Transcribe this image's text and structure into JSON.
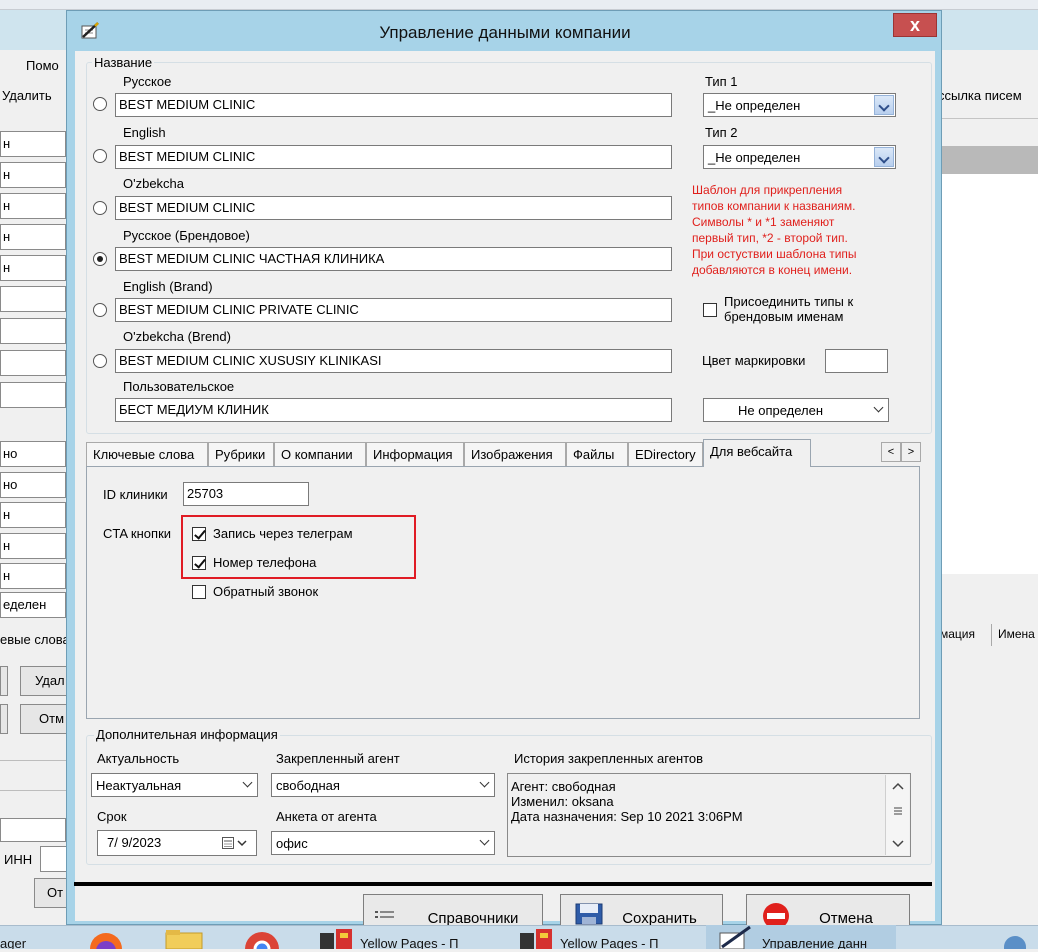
{
  "background_app": {
    "menu_item": "Помо",
    "delete_label": "Удалить",
    "mailing_label": "ссылка писем",
    "left_fields": [
      "н",
      "н",
      "н",
      "н",
      "н",
      "",
      "",
      "",
      "",
      "но",
      "но",
      "н",
      "н",
      "н",
      "еделен"
    ],
    "keywords_tab": "евые слова",
    "delete_button": "Удал",
    "cancel_button": "Отм",
    "inn_label": "ИНН",
    "bottom_button": "От",
    "right_tabs": [
      "мация",
      "Имена"
    ]
  },
  "dialog": {
    "title": "Управление данными компании",
    "close_symbol": "x",
    "name_group": {
      "legend": "Название",
      "fields": [
        {
          "label": "Русское",
          "value": "BEST MEDIUM CLINIC",
          "selected": false
        },
        {
          "label": "English",
          "value": "BEST MEDIUM CLINIC",
          "selected": false
        },
        {
          "label": "O'zbekcha",
          "value": "BEST MEDIUM CLINIC",
          "selected": false
        },
        {
          "label": "Русское (Брендовое)",
          "value": "BEST MEDIUM CLINIC ЧАСТНАЯ КЛИНИКА",
          "selected": true
        },
        {
          "label": "English (Brand)",
          "value": "BEST MEDIUM CLINIC PRIVATE CLINIC",
          "selected": false
        },
        {
          "label": "O'zbekcha (Brend)",
          "value": "BEST MEDIUM CLINIC XUSUSIY KLINIKASI",
          "selected": false
        },
        {
          "label": "Пользовательское",
          "value": "БЕСТ МЕДИУМ КЛИНИК"
        }
      ],
      "type1_label": "Тип 1",
      "type1_value": "_Не определен",
      "type2_label": "Тип 2",
      "type2_value": "_Не определен",
      "template_note": [
        "Шаблон для прикрепления",
        "типов компании к названиям.",
        "Символы * и *1 заменяют",
        "первый тип, *2 - второй тип.",
        "При остуствии шаблона типы",
        "добавляются в конец имени."
      ],
      "attach_types_label_line1": "Присоединить типы к",
      "attach_types_label_line2": "брендовым именам",
      "attach_types_checked": false,
      "color_label": "Цвет маркировки",
      "color_value": "",
      "custom_type_value": "Не определен"
    },
    "tabs": [
      "Ключевые слова",
      "Рубрики",
      "О компании",
      "Информация",
      "Изображения",
      "Файлы",
      "EDirectory",
      "Для вебсайта"
    ],
    "active_tab": "Для вебсайта",
    "tab_scroll_left": "<",
    "tab_scroll_right": ">",
    "website": {
      "clinic_id_label": "ID клиники",
      "clinic_id_value": "25703",
      "cta_label": "CTA кнопки",
      "cta": [
        {
          "label": "Запись через телеграм",
          "checked": true
        },
        {
          "label": "Номер телефона",
          "checked": true
        },
        {
          "label": "Обратный звонок",
          "checked": false
        }
      ]
    },
    "additional": {
      "legend": "Дополнительная информация",
      "relevance_label": "Актуальность",
      "relevance_value": "Неактуальная",
      "agent_label": "Закрепленный агент",
      "agent_value": "свободная",
      "history_label": "История закрепленных агентов",
      "history_lines": [
        "Агент: свободная",
        "Изменил: oksana",
        "Дата назначения: Sep 10 2021  3:06PM"
      ],
      "term_label": "Срок",
      "term_value": "7/  9/2023",
      "form_label": "Анкета от агента",
      "form_value": "офис"
    },
    "buttons": {
      "references": "Справочники",
      "save": "Сохранить",
      "cancel": "Отмена"
    }
  },
  "taskbar": {
    "items": [
      "ager",
      "Yellow Pages - П",
      "Yellow Pages - П",
      "Управление данн"
    ]
  },
  "colors": {
    "dialog_frame": "#a7d3e8",
    "close_button": "#c75050",
    "note_red": "#e0201c",
    "highlight_red": "#e01b24"
  }
}
